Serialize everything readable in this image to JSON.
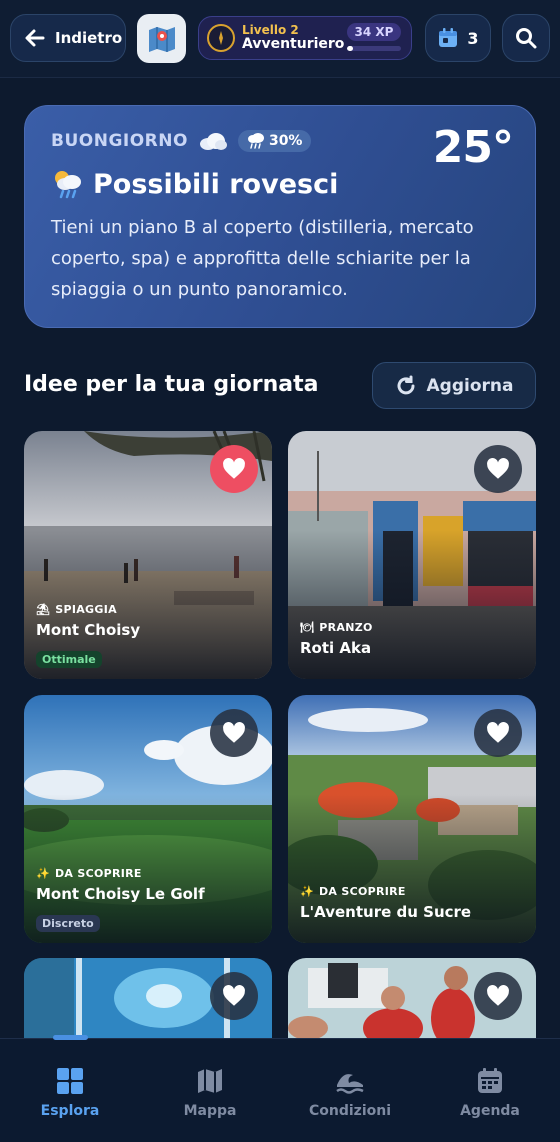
{
  "header": {
    "back_label": "Indietro",
    "level_label": "Livello 2",
    "level_title": "Avventuriero",
    "xp_label": "34 XP",
    "xp_progress": 0.12,
    "agenda_count": "3"
  },
  "weather": {
    "greeting": "BUONGIORNO",
    "rain_chance": "30%",
    "temperature": "25°",
    "title": "Possibili rovesci",
    "description": "Tieni un piano B al coperto (distilleria, mercato coperto, spa) e approfitta delle schiarite per la spiaggia o un punto panoramico."
  },
  "ideas": {
    "title": "Idee per la tua giornata",
    "refresh_label": "Aggiorna",
    "cards": [
      {
        "category": "SPIAGGIA",
        "name": "Mont Choisy",
        "badge": "Ottimale",
        "favorite": true
      },
      {
        "category": "PRANZO",
        "name": "Roti Aka",
        "badge": "",
        "favorite": false
      },
      {
        "category": "DA SCOPRIRE",
        "name": "Mont Choisy Le Golf",
        "badge": "Discreto",
        "favorite": false
      },
      {
        "category": "DA SCOPRIRE",
        "name": "L'Aventure du Sucre",
        "badge": "",
        "favorite": false
      },
      {
        "category": "",
        "name": "",
        "badge": "",
        "favorite": false
      },
      {
        "category": "",
        "name": "",
        "badge": "",
        "favorite": false
      }
    ]
  },
  "nav": {
    "items": [
      {
        "label": "Esplora",
        "icon": "grid-icon",
        "active": true
      },
      {
        "label": "Mappa",
        "icon": "map-icon",
        "active": false
      },
      {
        "label": "Condizioni",
        "icon": "wave-icon",
        "active": false
      },
      {
        "label": "Agenda",
        "icon": "calendar-icon",
        "active": false
      }
    ]
  },
  "colors": {
    "background": "#0d1a2e",
    "accent": "#5aa2f0",
    "favorite": "#ee4e62",
    "weather_card": "#3a5ea8"
  }
}
